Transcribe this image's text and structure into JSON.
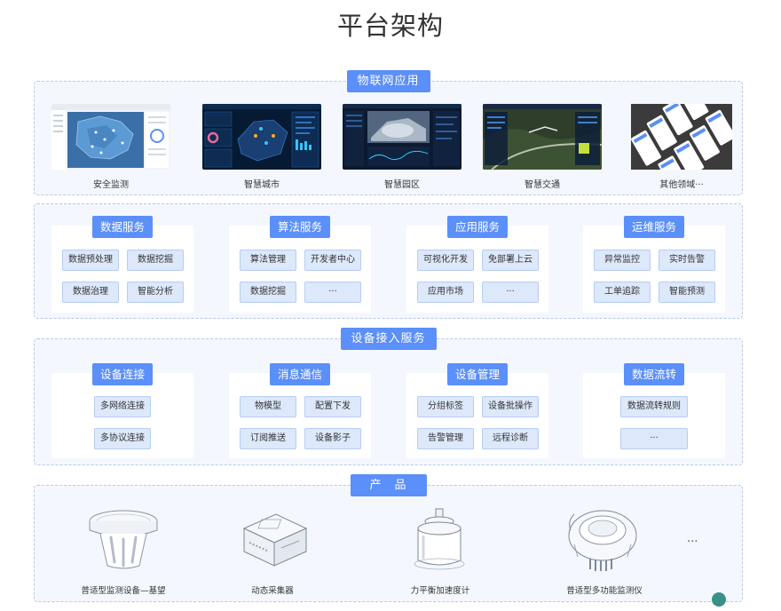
{
  "title": "平台架构",
  "iot_apps": {
    "tag": "物联网应用",
    "items": [
      {
        "label": "安全监测"
      },
      {
        "label": "智慧城市"
      },
      {
        "label": "智慧园区"
      },
      {
        "label": "智慧交通"
      },
      {
        "label": "其他领域···"
      }
    ]
  },
  "services": {
    "boxes": [
      {
        "title": "数据服务",
        "chips": [
          "数据预处理",
          "数据挖掘",
          "数据治理",
          "智能分析"
        ]
      },
      {
        "title": "算法服务",
        "chips": [
          "算法管理",
          "开发者中心",
          "数据挖掘",
          "···"
        ]
      },
      {
        "title": "应用服务",
        "chips": [
          "可视化开发",
          "免部署上云",
          "应用市场",
          "···"
        ]
      },
      {
        "title": "运维服务",
        "chips": [
          "异常监控",
          "实时告警",
          "工单追踪",
          "智能预测"
        ]
      }
    ]
  },
  "access": {
    "tag": "设备接入服务",
    "boxes": [
      {
        "title": "设备连接",
        "chips": [
          "多网络连接",
          "多协议连接"
        ]
      },
      {
        "title": "消息通信",
        "chips": [
          "物模型",
          "配置下发",
          "订阅推送",
          "设备影子"
        ]
      },
      {
        "title": "设备管理",
        "chips": [
          "分组标签",
          "设备批操作",
          "告警管理",
          "远程诊断"
        ]
      },
      {
        "title": "数据流转",
        "chips": [
          "数据流转规则",
          "···"
        ]
      }
    ]
  },
  "products": {
    "tag": "产　品",
    "items": [
      {
        "label": "普适型监测设备—基望",
        "icon": "monitoring-device-icon"
      },
      {
        "label": "动态采集器",
        "icon": "data-collector-icon"
      },
      {
        "label": "力平衡加速度计",
        "icon": "accelerometer-icon"
      },
      {
        "label": "普适型多功能监测仪",
        "icon": "multifunction-monitor-icon"
      }
    ],
    "more": "···"
  },
  "colors": {
    "accent": "#5b8ff9",
    "chip_bg": "#dde8fb",
    "section_bg": "#f4f8fe"
  }
}
